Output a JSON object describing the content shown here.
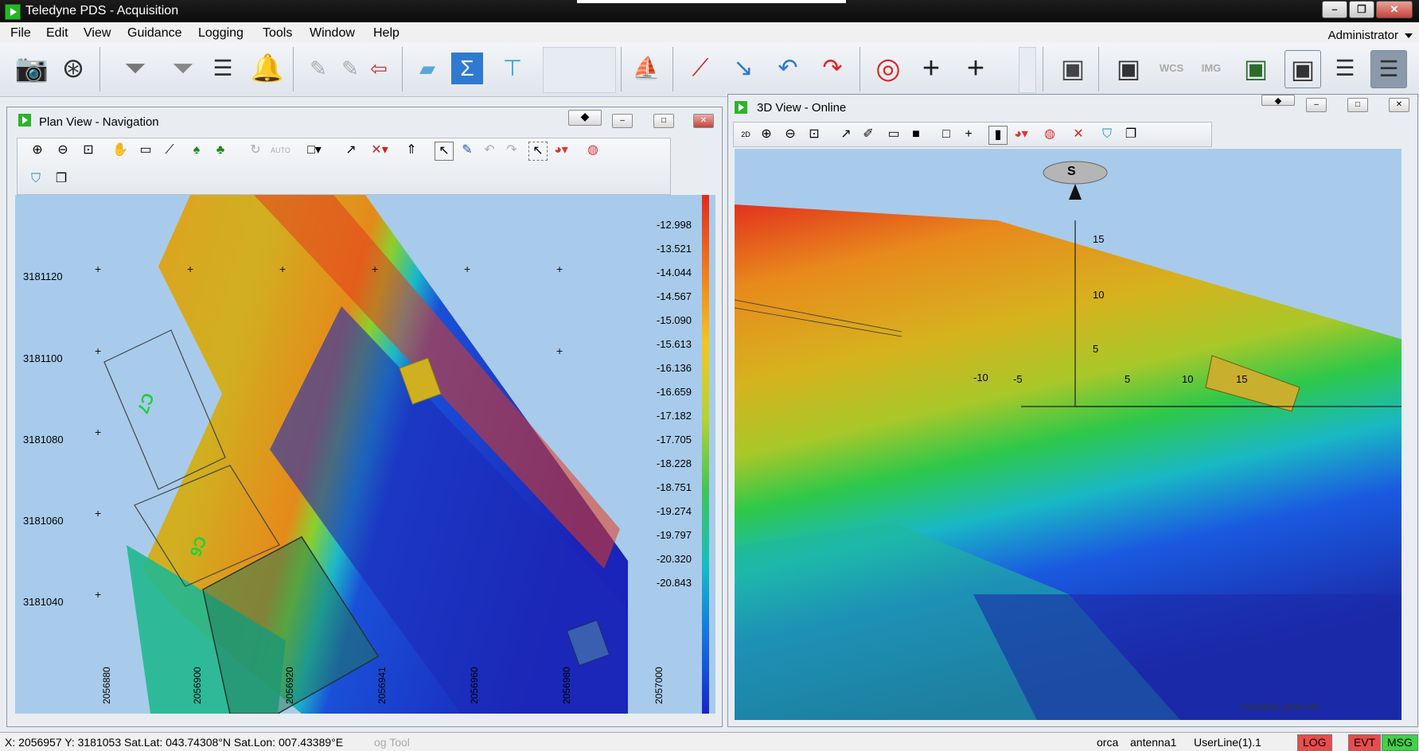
{
  "app": {
    "title": "Teledyne PDS - Acquisition"
  },
  "menu": [
    "File",
    "Edit",
    "View",
    "Guidance",
    "Logging",
    "Tools",
    "Window",
    "Help"
  ],
  "user": "Administrator",
  "main_toolbar": {
    "icons": [
      "camera-icon",
      "film-reel-icon",
      "filter-icon",
      "filter-funnel-icon",
      "sliders-icon",
      "alarm-bell-icon",
      "edit-pen-icon",
      "edit-pen-arrow-icon",
      "exit-arrow-icon",
      "device-icon",
      "sigma-icon",
      "hierarchy-icon",
      "vessel-icon",
      "select-line-icon",
      "line-arrow-1-icon",
      "line-arrow-2-icon",
      "line-arrow-3-icon",
      "lifebuoy-icon",
      "add-cursor-icon",
      "add-point-icon",
      "save-edit-icon",
      "save-check-icon",
      "wcs-icon",
      "img-icon",
      "save-export-icon",
      "save-warning-icon",
      "sliders-check-icon",
      "list-check-icon"
    ],
    "wcs_label": "WCS",
    "img_label": "IMG"
  },
  "plan_view": {
    "title": "Plan View - Navigation",
    "y_ticks": [
      "3181120",
      "3181100",
      "3181080",
      "3181060",
      "3181040"
    ],
    "x_ticks": [
      "2056880",
      "2056900",
      "2056920",
      "2056941",
      "2056960",
      "2056980",
      "2057000"
    ],
    "depth_scale": [
      "-12.998",
      "-13.521",
      "-14.044",
      "-14.567",
      "-15.090",
      "-15.613",
      "-16.136",
      "-16.659",
      "-17.182",
      "-17.705",
      "-18.228",
      "-18.751",
      "-19.274",
      "-19.797",
      "-20.320",
      "-20.843"
    ],
    "grid_labels": [
      "C7",
      "C6"
    ],
    "toolbar_icons": [
      "zoom-in-icon",
      "zoom-out-icon",
      "zoom-extent-icon",
      "pan-hand-icon",
      "measure-icon",
      "ruler-icon",
      "tree-icon",
      "tree-color-icon",
      "rotate-icon",
      "auto-icon",
      "select-rect-icon",
      "line-icon",
      "track-icon",
      "upload-icon",
      "cursor-icon",
      "edit-icon",
      "undo-icon",
      "redo-icon",
      "grid-select-icon",
      "palette-icon",
      "color-wheel-icon"
    ]
  },
  "view3d": {
    "title": "3D View - Online",
    "compass_label": "S",
    "axis_labels": [
      "15",
      "10",
      "5",
      "-5",
      "5",
      "10",
      "15"
    ],
    "axis_neg": "-10",
    "footer_text": "colortable_bpdcsaltl"
  },
  "status": {
    "coords": "X: 2056957  Y: 3181053 Sat.Lat: 043.74308°N Sat.Lon: 007.43389°E",
    "tool": "og Tool",
    "vessel": "orca",
    "antenna": "antenna1",
    "line": "UserLine(1).1",
    "log": "LOG",
    "evt": "EVT",
    "msg": "MSG"
  },
  "colors": {
    "log_bg": "#e84c4c",
    "evt_bg": "#e84c4c",
    "msg_bg": "#3fd14a",
    "plan_water": "#a8cbeb"
  }
}
